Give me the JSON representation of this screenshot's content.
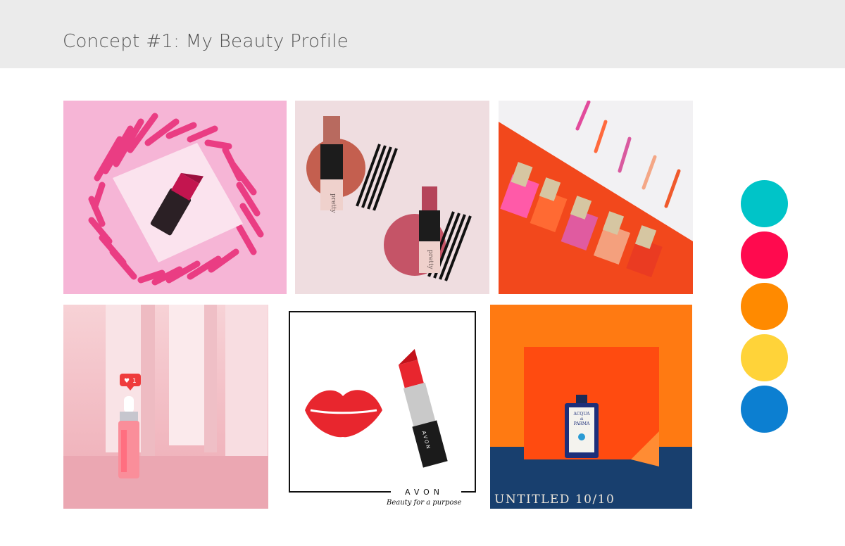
{
  "header": {
    "title": "Concept #1: My Beauty Profile"
  },
  "tiles": {
    "pretty_text": "pretty",
    "like_count": "1",
    "avon_brand": "AVON",
    "avon_tagline": "Beauty for a purpose",
    "avon_stick_brand": "AVON",
    "perfume_line1": "ACQUA",
    "perfume_line2": "di",
    "perfume_line3": "PARMA",
    "untitled_caption": "UNTITLED 10/10"
  },
  "palette": {
    "colors": [
      "#00c4c8",
      "#ff0a4e",
      "#ff8a00",
      "#ffd339",
      "#0c7fd1"
    ]
  }
}
